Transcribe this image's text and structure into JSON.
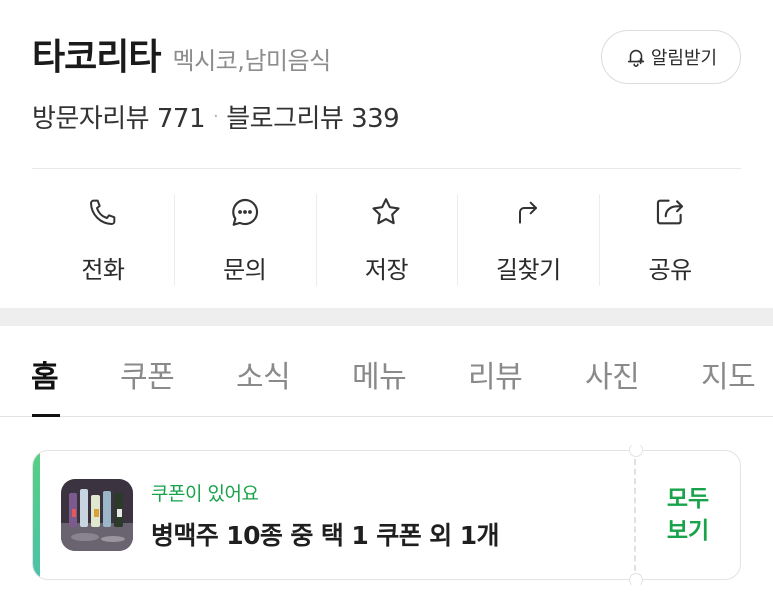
{
  "place": {
    "name": "타코리타",
    "category": "멕시코,남미음식",
    "alarm_label": "알림받기"
  },
  "reviews": {
    "visitor_label": "방문자리뷰 771",
    "separator": "·",
    "blog_label": "블로그리뷰 339"
  },
  "actions": [
    {
      "label": "전화",
      "icon": "phone-icon"
    },
    {
      "label": "문의",
      "icon": "chat-bubble-icon"
    },
    {
      "label": "저장",
      "icon": "star-icon"
    },
    {
      "label": "길찾기",
      "icon": "directions-arrow-icon"
    },
    {
      "label": "공유",
      "icon": "share-icon"
    }
  ],
  "tabs": [
    {
      "label": "홈",
      "active": true
    },
    {
      "label": "쿠폰",
      "active": false
    },
    {
      "label": "소식",
      "active": false
    },
    {
      "label": "메뉴",
      "active": false
    },
    {
      "label": "리뷰",
      "active": false
    },
    {
      "label": "사진",
      "active": false
    },
    {
      "label": "지도",
      "active": false
    }
  ],
  "coupon": {
    "tag": "쿠폰이 있어요",
    "title": "병맥주 10종 중 택 1 쿠폰 외 1개",
    "view_all": "모두\n보기"
  },
  "colors": {
    "accent_green": "#18a34a",
    "text_primary": "#1a1a1a",
    "text_secondary": "#8d8d8d"
  }
}
